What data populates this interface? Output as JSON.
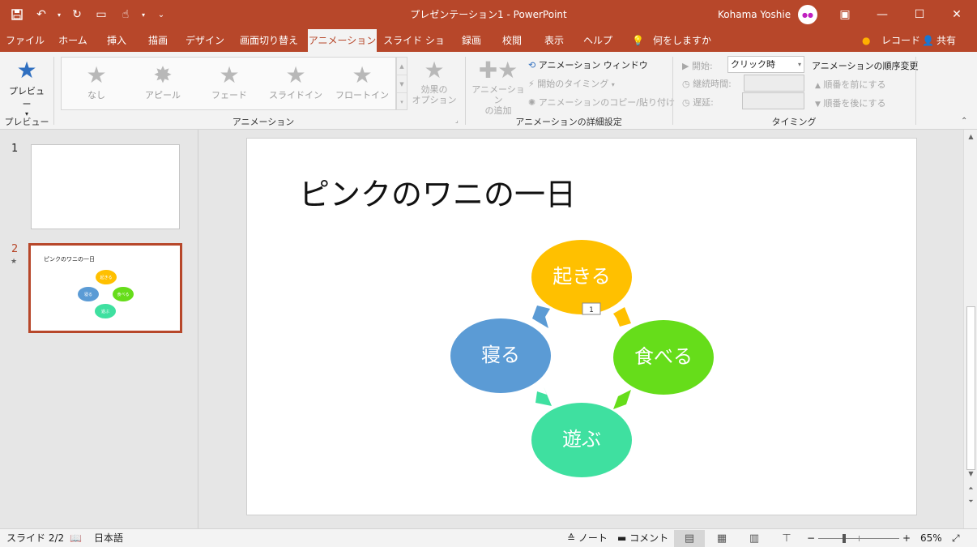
{
  "window": {
    "title": "プレゼンテーション1  -  PowerPoint",
    "user": "Kohama Yoshie",
    "avatar_text": "●●"
  },
  "qat": [
    "save-icon",
    "undo-icon",
    "redo-icon",
    "start-from-beginning-icon",
    "touch-mode-icon",
    "customize-icon"
  ],
  "tabs": [
    {
      "label": "ファイル"
    },
    {
      "label": "ホーム"
    },
    {
      "label": "挿入"
    },
    {
      "label": "描画"
    },
    {
      "label": "デザイン"
    },
    {
      "label": "画面切り替え"
    },
    {
      "label": "アニメーション"
    },
    {
      "label": "スライド ショー"
    },
    {
      "label": "録画"
    },
    {
      "label": "校閲"
    },
    {
      "label": "表示"
    },
    {
      "label": "ヘルプ"
    }
  ],
  "tell_me": "何をしますか",
  "record": "レコード",
  "share": "共有",
  "ribbon": {
    "preview": {
      "label": "プレビュー",
      "group": "プレビュー"
    },
    "gallery": {
      "group": "アニメーション",
      "items": [
        "なし",
        "アピール",
        "フェード",
        "スライドイン",
        "フロートイン"
      ],
      "effect_options": [
        "効果の",
        "オプション"
      ]
    },
    "advanced": {
      "group": "アニメーションの詳細設定",
      "add": [
        "アニメーション",
        "の追加"
      ],
      "pane": "アニメーション ウィンドウ",
      "trigger": "開始のタイミング",
      "painter": "アニメーションのコピー/貼り付け"
    },
    "timing": {
      "group": "タイミング",
      "start_label": "開始:",
      "start_value": "クリック時",
      "duration_label": "継続時間:",
      "delay_label": "遅延:",
      "reorder_title": "アニメーションの順序変更",
      "move_earlier": "順番を前にする",
      "move_later": "順番を後にする"
    }
  },
  "thumbnails": [
    {
      "number": "1"
    },
    {
      "number": "2",
      "marker": "★",
      "title": "ピンクのワニの一日"
    }
  ],
  "slide": {
    "title": "ピンクのワニの一日",
    "nodes": [
      {
        "label": "起きる",
        "color": "#ffc000"
      },
      {
        "label": "食べる",
        "color": "#66dd1a"
      },
      {
        "label": "遊ぶ",
        "color": "#3fe0a0"
      },
      {
        "label": "寝る",
        "color": "#5b9bd5"
      }
    ],
    "animation_tag": "1"
  },
  "status": {
    "slide_info": "スライド 2/2",
    "language": "日本語",
    "notes": "ノート",
    "comments": "コメント",
    "zoom": "65%"
  }
}
